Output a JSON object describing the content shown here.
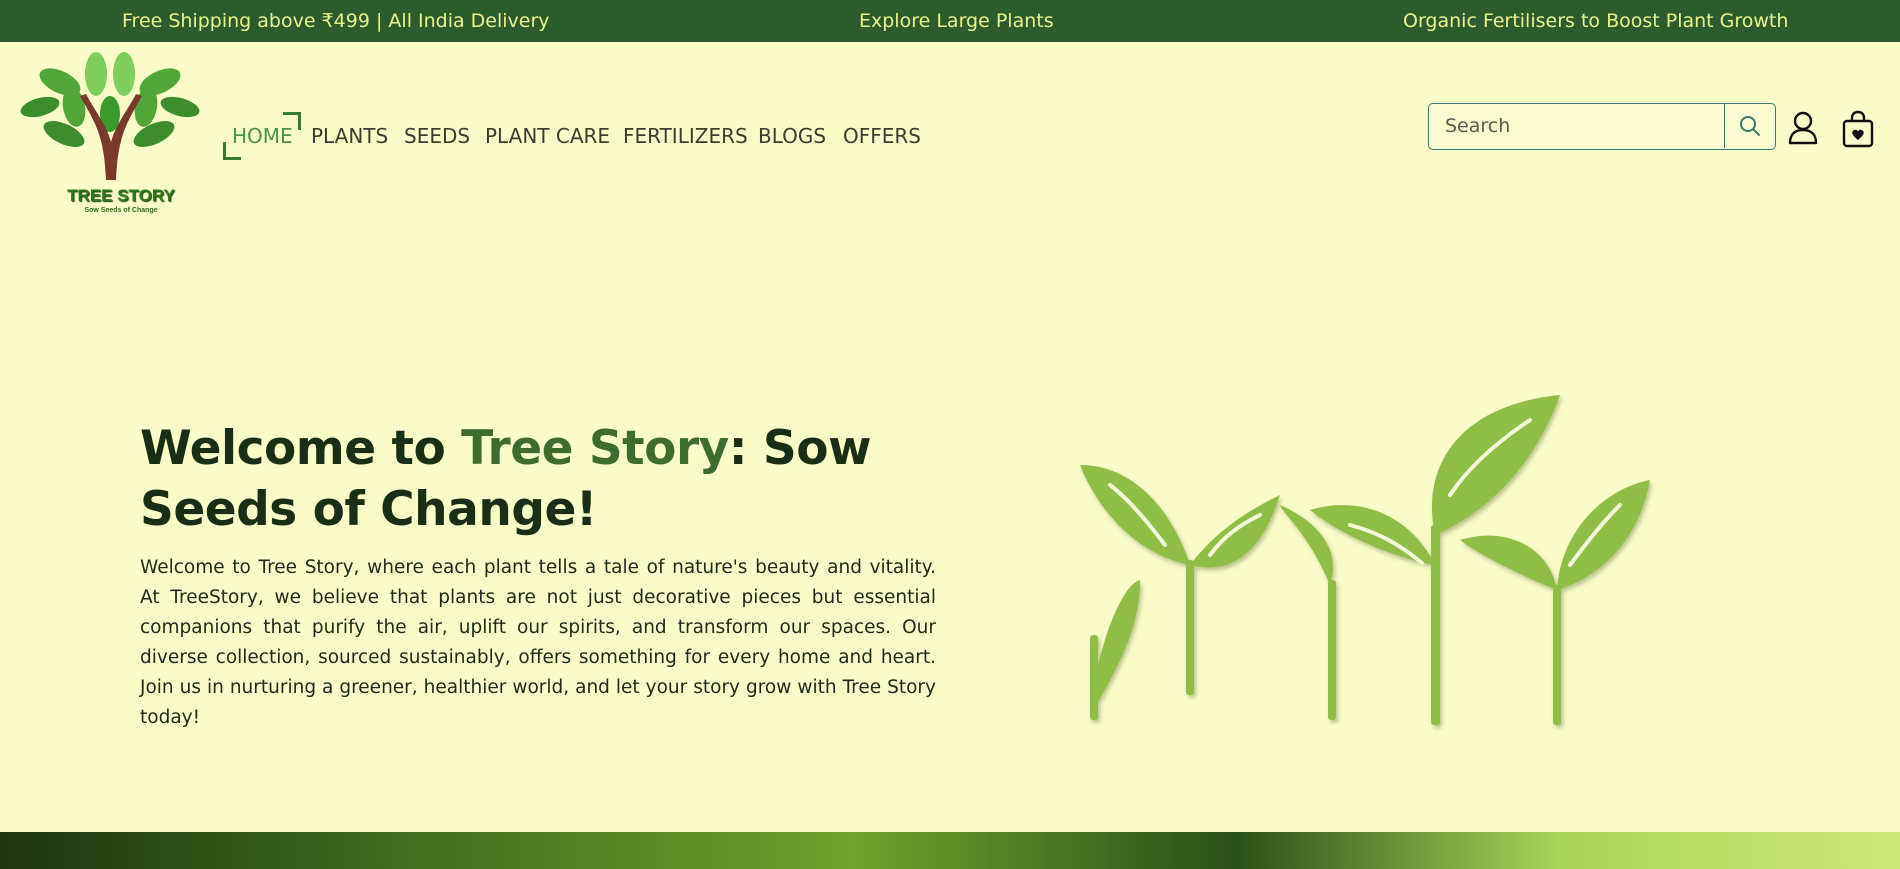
{
  "announcements": [
    "Free Shipping above ₹499 | All India Delivery",
    "Explore Large Plants",
    "Organic Fertilisers to Boost Plant Growth"
  ],
  "brand": {
    "name": "TREE STORY",
    "tagline": "Sow Seeds of Change"
  },
  "nav": {
    "items": [
      {
        "label": "HOME",
        "active": true
      },
      {
        "label": "PLANTS"
      },
      {
        "label": "SEEDS"
      },
      {
        "label": "PLANT CARE"
      },
      {
        "label": "FERTILIZERS"
      },
      {
        "label": "BLOGS"
      },
      {
        "label": "OFFERS"
      }
    ]
  },
  "search": {
    "placeholder": "Search"
  },
  "icons": {
    "search": "search-icon",
    "account": "user-icon",
    "cart": "shopping-bag-icon"
  },
  "hero": {
    "title_prefix": "Welcome to ",
    "title_accent": "Tree Story",
    "title_suffix": ": Sow Seeds of Change!",
    "body": "Welcome to Tree Story, where each plant tells a tale of nature's beauty and vitality. At TreeStory, we believe that plants are not just decorative pieces but essential companions that purify the air, uplift our spirits, and transform our spaces. Our diverse collection, sourced sustainably, offers something for every home and heart. Join us in nurturing a greener, healthier world, and let your story grow with Tree Story today!"
  },
  "colors": {
    "background": "#fafcc8",
    "topbar": "#2e5b2e",
    "topbar_text": "#e9f28a",
    "accent": "#3f6b2f",
    "leaf": "#8fbd45"
  }
}
